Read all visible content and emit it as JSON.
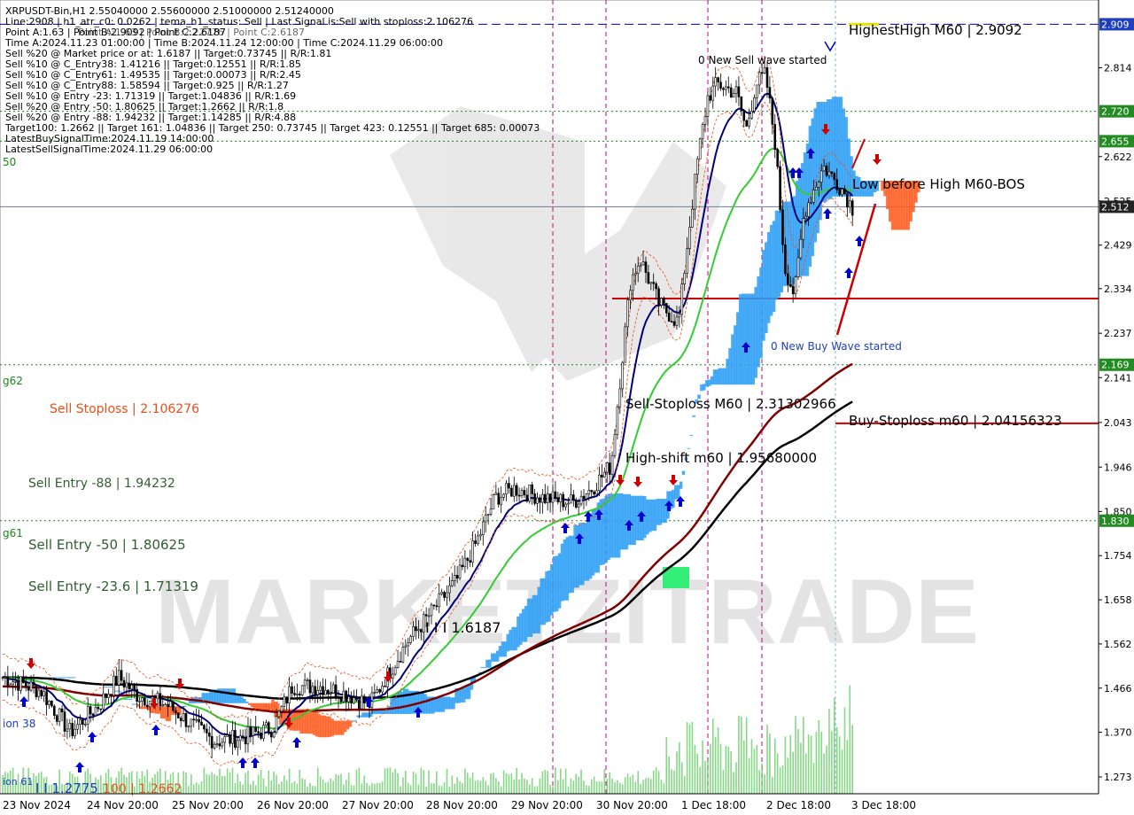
{
  "header": {
    "title": "XRPUSDT-Bin,H1  2.55040000 2.55600000 2.51000000 2.51240000",
    "lines": [
      "Line:2908 | h1_atr_c0: 0.0262 | tema_h1_status: Sell | Last Signal is:Sell with stoploss:2.106276",
      "Point A:1.63 | Point B:2.9092 | Point C:2.6187",
      "Time A:2024.11.23 01:00:00 | Time B:2024.11.24 12:00:00 | Time C:2024.11.29 06:00:00",
      "Sell %20 @ Market price or at: 1.6187 || Target:0.73745 || R/R:1.81",
      "Sell %10 @ C_Entry38: 1.41216 || Target:0.12551 || R/R:1.85",
      "Sell %10 @ C_Entry61: 1.49535 || Target:0.00073 || R/R:2.45",
      "Sell %10 @ C_Entry88: 1.58594 || Target:0.925 || R/R:1.27",
      "Sell %10 @ Entry -23: 1.71319 || Target:1.04836 || R/R:1.69",
      "Sell %20 @ Entry -50: 1.80625 || Target:1.2662 || R/R:1.8",
      "Sell %20 @ Entry -88: 1.94232 || Target:1.14285 || R/R:4.88",
      "Target100: 1.2662 || Target 161: 1.04836 || Target 250: 0.73745 || Target 423: 0.12551 || Target 685: 0.00073",
      "LatestBuySignalTime:2024.11.19 14:00:00",
      "LatestSellSignalTime:2024.11.29 06:00:00"
    ],
    "overlap": "Point A:1.63 | Point B:2.22776 | Point C:2.6187"
  },
  "annotations": {
    "highest_high": "HighestHigh   M60 | 2.9092",
    "sell_wave": "0 New Sell wave started",
    "low_before_high": "Low before High   M60-BOS",
    "buy_wave": "0 New Buy Wave started",
    "sell_stoploss_m60": "Sell-Stoploss M60 | 2.31302966",
    "buy_stoploss_m60": "Buy-Stoploss m60 | 2.04156323",
    "high_shift": "High-shift m60 | 1.95680000",
    "sell_stoploss": "Sell Stoploss | 2.106276",
    "sell_entry_88": "Sell Entry -88 | 1.94232",
    "sell_entry_50": "Sell Entry -50 | 1.80625",
    "sell_entry_23": "Sell Entry -23.6 | 1.71319",
    "point_c_marker": "I I I 1.6187",
    "left_edge_labels": [
      "50",
      "g62",
      "g61",
      "ion 38",
      "ion 61",
      "I I 1.2775",
      "100 | 1.2662"
    ],
    "watermark": "MARKETZITRADE"
  },
  "colors": {
    "sell_red": "#cc0000",
    "buy_blue": "#0000cc",
    "level_green": "#1a8a1a",
    "price_badge": "#333333",
    "level_badge": "#228b22",
    "high_badge": "#1f3fbf",
    "cloud_blue": "#1e90ff",
    "cloud_red": "#ff4500",
    "tema_navy": "#00007a",
    "ma_green": "#33cc33",
    "ma_black": "#000000",
    "ma_maroon": "#800000"
  },
  "chart_data": {
    "type": "candlestick",
    "symbol": "XRPUSDT-Bin",
    "timeframe": "H1",
    "ohlc_last": {
      "open": 2.5504,
      "high": 2.556,
      "low": 2.51,
      "close": 2.5124
    },
    "y_ticks": [
      2.8145,
      2.6215,
      2.525,
      2.429,
      2.3345,
      2.2375,
      2.141,
      2.0435,
      1.9465,
      1.85,
      1.754,
      1.658,
      1.562,
      1.466,
      1.37,
      1.273
    ],
    "x_ticks": [
      "23 Nov 2024",
      "24 Nov 20:00",
      "25 Nov 20:00",
      "26 Nov 20:00",
      "27 Nov 20:00",
      "28 Nov 20:00",
      "29 Nov 20:00",
      "30 Nov 20:00",
      "1 Dec 18:00",
      "2 Dec 18:00",
      "3 Dec 18:00"
    ],
    "ylim": [
      1.23,
      2.96
    ],
    "level_badges": [
      {
        "value": 2.9092,
        "label": "2.909",
        "kind": "high"
      },
      {
        "value": 2.72,
        "label": "2.720",
        "kind": "level"
      },
      {
        "value": 2.655,
        "label": "2.655",
        "kind": "level"
      },
      {
        "value": 2.5124,
        "label": "2.512",
        "kind": "price"
      },
      {
        "value": 2.169,
        "label": "2.169",
        "kind": "level"
      },
      {
        "value": 1.83,
        "label": "1.830",
        "kind": "level"
      }
    ],
    "levels": {
      "highest_high": 2.9092,
      "green_dotted": [
        2.72,
        2.655,
        2.169,
        1.83
      ],
      "current": 2.5124,
      "sell_stoploss_m60": 2.31302966,
      "buy_stoploss_m60": 2.04156323
    },
    "close_path": [
      [
        0,
        1.49
      ],
      [
        0.04,
        1.46
      ],
      [
        0.07,
        1.37
      ],
      [
        0.1,
        1.43
      ],
      [
        0.12,
        1.49
      ],
      [
        0.14,
        1.45
      ],
      [
        0.17,
        1.43
      ],
      [
        0.2,
        1.38
      ],
      [
        0.22,
        1.35
      ],
      [
        0.25,
        1.36
      ],
      [
        0.28,
        1.38
      ],
      [
        0.3,
        1.47
      ],
      [
        0.33,
        1.47
      ],
      [
        0.36,
        1.45
      ],
      [
        0.38,
        1.43
      ],
      [
        0.4,
        1.5
      ],
      [
        0.42,
        1.57
      ],
      [
        0.44,
        1.62
      ],
      [
        0.47,
        1.7
      ],
      [
        0.49,
        1.78
      ],
      [
        0.51,
        1.88
      ],
      [
        0.53,
        1.9
      ],
      [
        0.56,
        1.88
      ],
      [
        0.59,
        1.87
      ],
      [
        0.61,
        1.9
      ],
      [
        0.63,
        1.95
      ],
      [
        0.64,
        2.15
      ],
      [
        0.65,
        2.35
      ],
      [
        0.66,
        2.4
      ],
      [
        0.68,
        2.3
      ],
      [
        0.7,
        2.26
      ],
      [
        0.71,
        2.45
      ],
      [
        0.72,
        2.62
      ],
      [
        0.73,
        2.75
      ],
      [
        0.74,
        2.78
      ],
      [
        0.76,
        2.76
      ],
      [
        0.77,
        2.68
      ],
      [
        0.78,
        2.78
      ],
      [
        0.79,
        2.8
      ],
      [
        0.8,
        2.65
      ],
      [
        0.81,
        2.38
      ],
      [
        0.82,
        2.32
      ],
      [
        0.83,
        2.5
      ],
      [
        0.84,
        2.55
      ],
      [
        0.85,
        2.6
      ],
      [
        0.87,
        2.55
      ],
      [
        0.88,
        2.51
      ]
    ],
    "volume_note": "volume histogram bars at bottom"
  }
}
